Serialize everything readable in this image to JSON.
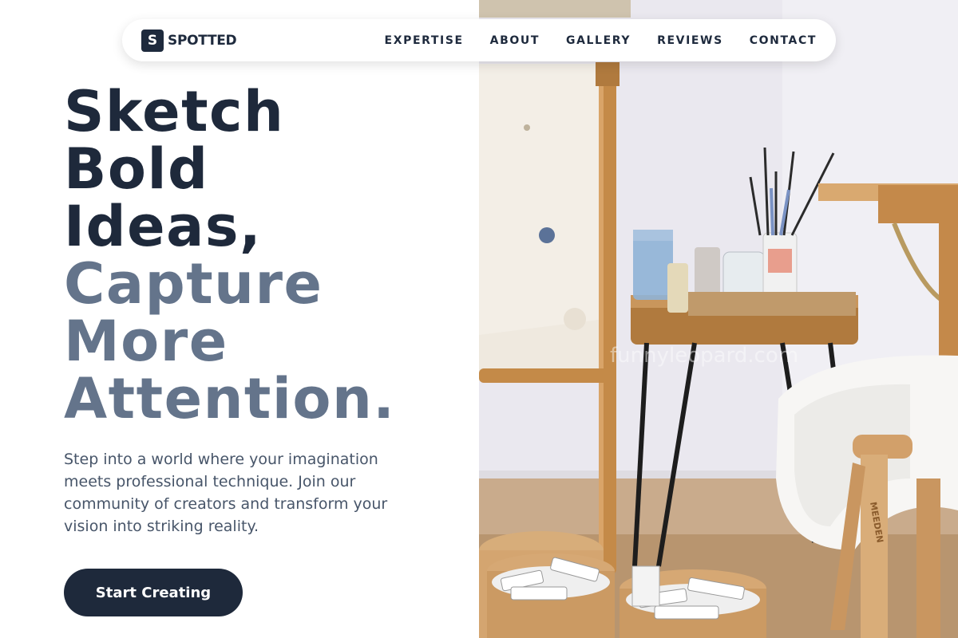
{
  "nav": {
    "logo_letter": "S",
    "brand": "SPOTTED",
    "items": [
      {
        "label": "EXPERTISE"
      },
      {
        "label": "ABOUT"
      },
      {
        "label": "GALLERY"
      },
      {
        "label": "REVIEWS"
      },
      {
        "label": "CONTACT"
      }
    ]
  },
  "hero": {
    "headline_dark": [
      "Sketch",
      "Bold",
      "Ideas,"
    ],
    "headline_muted": [
      "Capture",
      "More",
      "Attention."
    ],
    "description": "Step into a world where your imagination meets professional technique. Join our community of creators and transform your vision into striking reality.",
    "cta_label": "Start Creating"
  },
  "photo": {
    "watermark": "funnyleopard.com",
    "stool_brand": "MEEDEN"
  },
  "colors": {
    "primary": "#1e293b",
    "muted": "#64748b",
    "body_text": "#475569"
  }
}
